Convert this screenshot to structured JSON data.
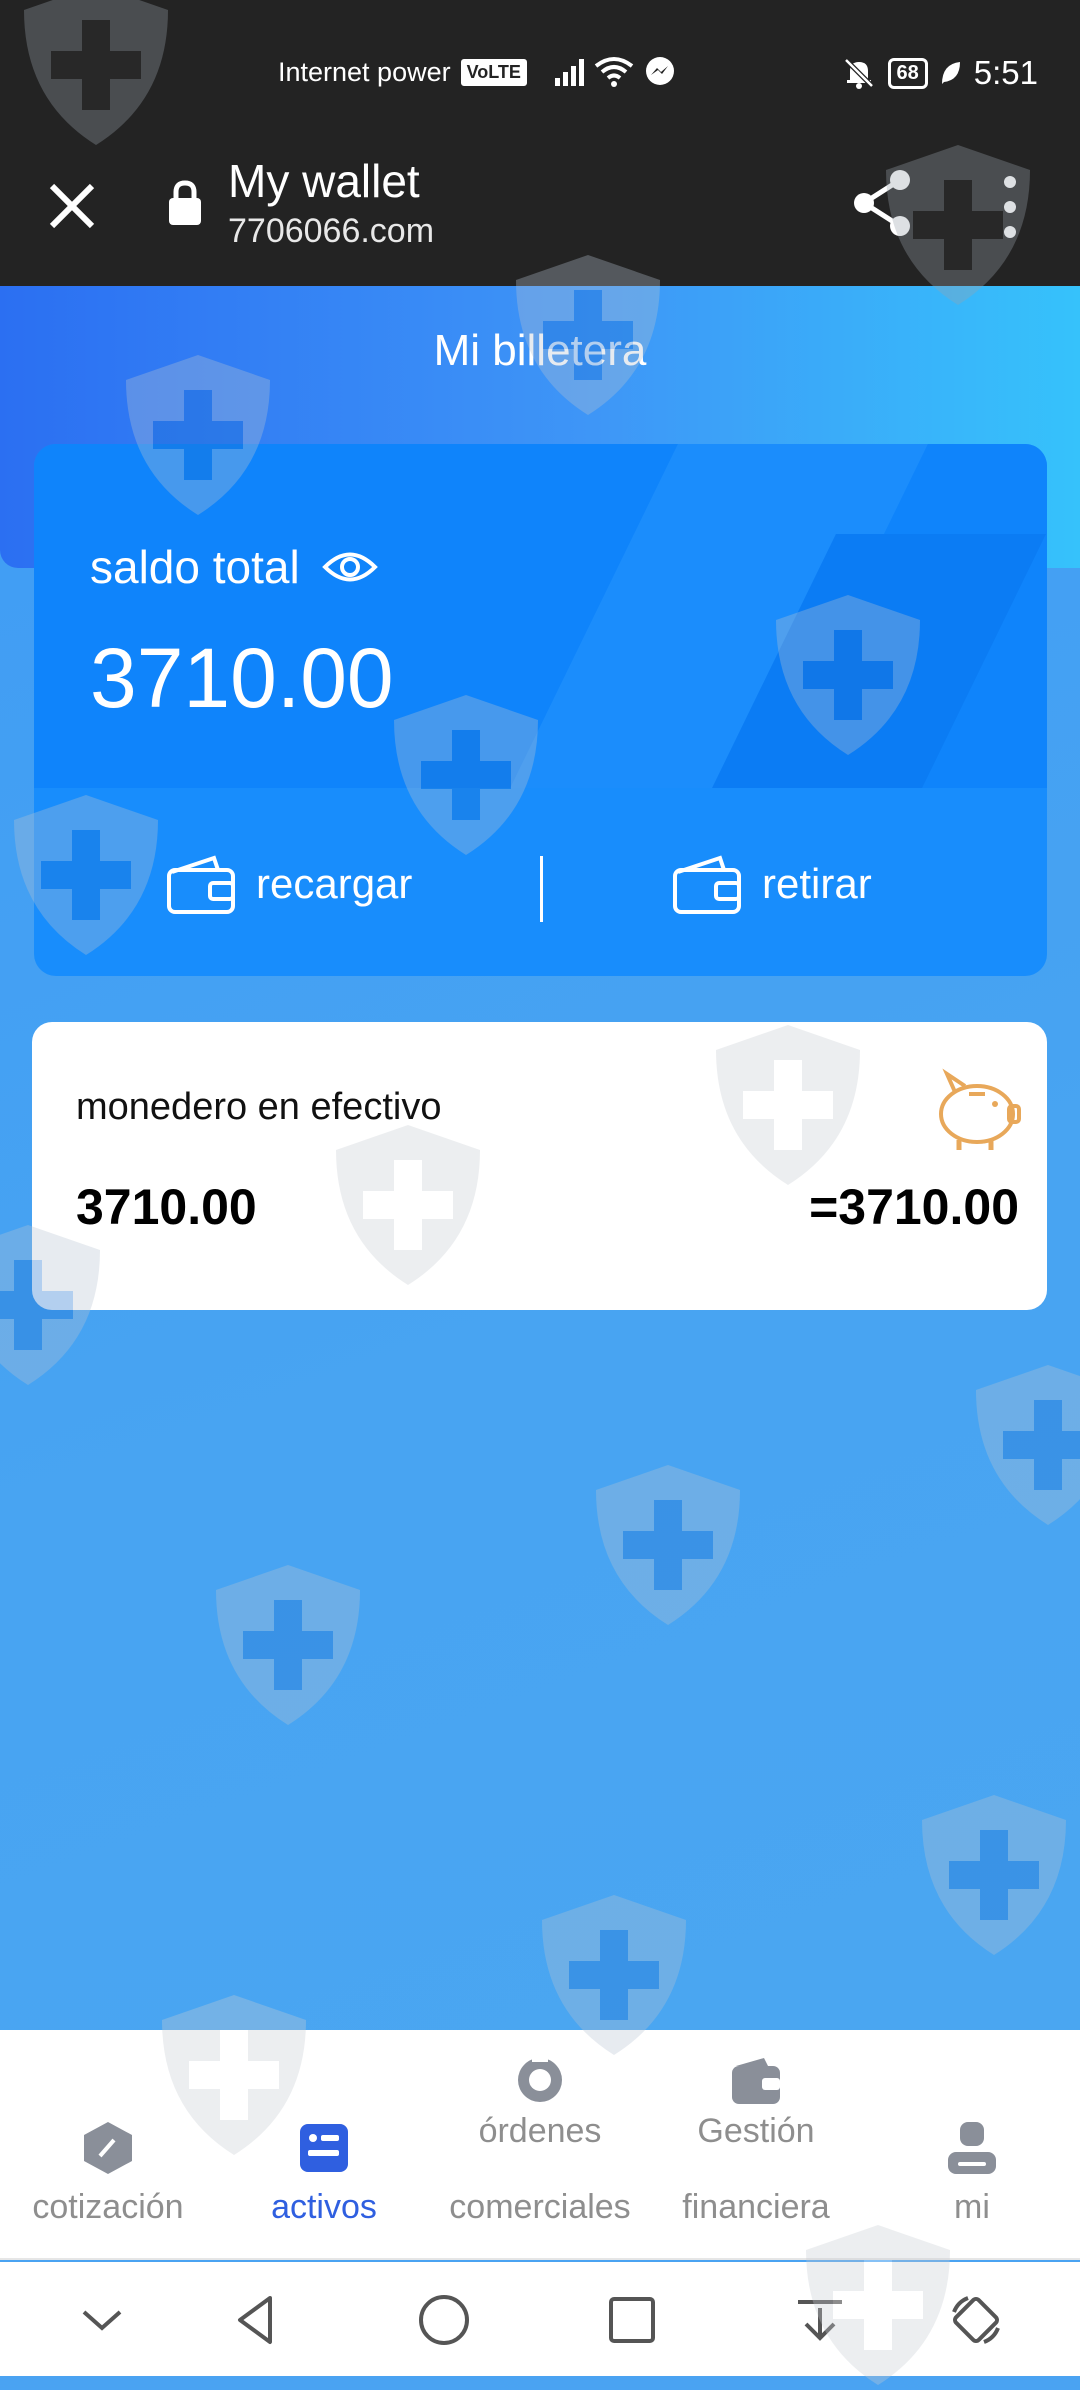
{
  "status_bar": {
    "carrier": "Internet power",
    "volte": "VoLTE",
    "battery": "68",
    "time": "5:51"
  },
  "browser": {
    "title": "My wallet",
    "url": "7706066.com"
  },
  "wallet": {
    "header_title": "Mi billetera",
    "total_label": "saldo total",
    "total_value": "3710.00",
    "recharge_label": "recargar",
    "withdraw_label": "retirar"
  },
  "cash_wallet": {
    "label": "monedero en efectivo",
    "value": "3710.00",
    "equivalent": "=3710.00"
  },
  "tabs": [
    {
      "line1": "",
      "line2": "cotización",
      "icon": "quote-icon"
    },
    {
      "line1": "",
      "line2": "activos",
      "icon": "assets-icon",
      "active": true
    },
    {
      "line1": "órdenes",
      "line2": "comerciales",
      "icon": "orders-icon"
    },
    {
      "line1": "Gestión",
      "line2": "financiera",
      "icon": "wallet-icon"
    },
    {
      "line1": "",
      "line2": "mi",
      "icon": "user-icon"
    }
  ],
  "colors": {
    "accent": "#2f5fe0",
    "card_blue": "#0f84fb",
    "page_blue": "#4aa3f2",
    "piggy": "#e8a85a"
  }
}
